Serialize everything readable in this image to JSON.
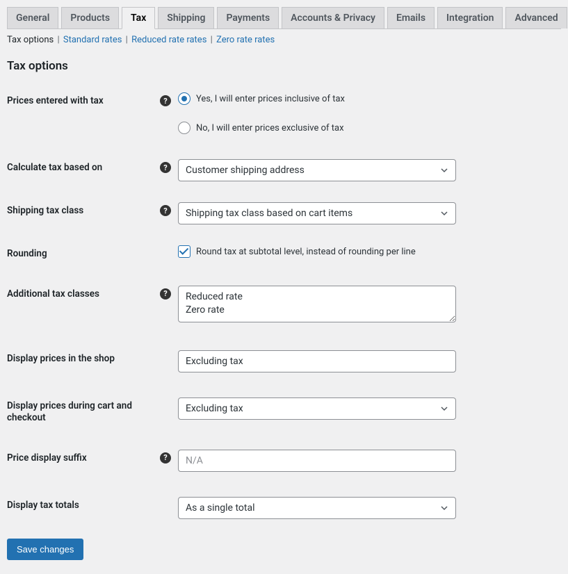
{
  "tabs": [
    {
      "label": "General"
    },
    {
      "label": "Products"
    },
    {
      "label": "Tax",
      "active": true
    },
    {
      "label": "Shipping"
    },
    {
      "label": "Payments"
    },
    {
      "label": "Accounts & Privacy"
    },
    {
      "label": "Emails"
    },
    {
      "label": "Integration"
    },
    {
      "label": "Advanced"
    }
  ],
  "subsections": {
    "current": "Tax options",
    "links": [
      "Standard rates",
      "Reduced rate rates",
      "Zero rate rates"
    ]
  },
  "heading": "Tax options",
  "fields": {
    "prices_entered": {
      "label": "Prices entered with tax",
      "opt_yes": "Yes, I will enter prices inclusive of tax",
      "opt_no": "No, I will enter prices exclusive of tax"
    },
    "calc_based": {
      "label": "Calculate tax based on",
      "value": "Customer shipping address"
    },
    "shipping_class": {
      "label": "Shipping tax class",
      "value": "Shipping tax class based on cart items"
    },
    "rounding": {
      "label": "Rounding",
      "text": "Round tax at subtotal level, instead of rounding per line"
    },
    "additional": {
      "label": "Additional tax classes",
      "value": "Reduced rate\nZero rate"
    },
    "display_shop": {
      "label": "Display prices in the shop",
      "value": "Excluding tax"
    },
    "display_cart": {
      "label": "Display prices during cart and checkout",
      "value": "Excluding tax"
    },
    "suffix": {
      "label": "Price display suffix",
      "placeholder": "N/A"
    },
    "totals": {
      "label": "Display tax totals",
      "value": "As a single total"
    }
  },
  "save_label": "Save changes",
  "help_glyph": "?"
}
